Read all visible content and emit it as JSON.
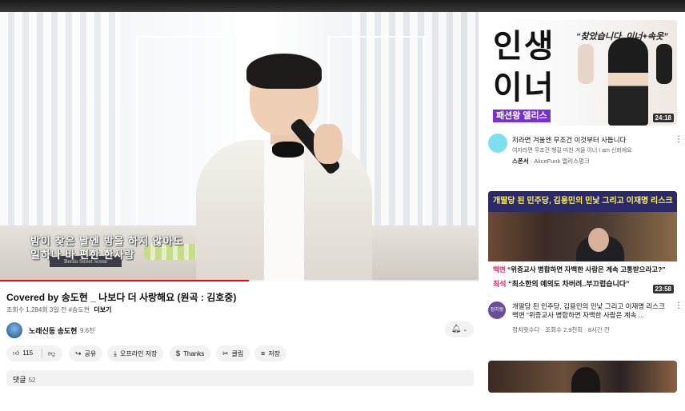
{
  "player": {
    "subtitle_line1": "밤이 찾은 날엔 밤을 하지 않아도",
    "subtitle_line2": "일하나 바 편한 한사람",
    "sign_text": "Berlin Street Scene",
    "progress_fraction": 0.52
  },
  "video": {
    "title": "Covered by 송도현 _ 나보다 더 사랑해요 (원곡 : 김호중)",
    "views": "조회수 1,284회",
    "age": "3일 전",
    "hashtag": "#송도현",
    "more_label": "더보기"
  },
  "channel": {
    "name": "노래신동 송도현",
    "subscribers": "9.6천",
    "bell_icon": "bell-icon"
  },
  "actions": {
    "likes": "115",
    "share": "공유",
    "offline_save": "오프라인 저장",
    "thanks": "Thanks",
    "clip": "클립",
    "save": "저장"
  },
  "comments": {
    "label": "댓글",
    "count": "52"
  },
  "sidebar": {
    "ad": {
      "thumb_big_line1": "인생",
      "thumb_big_line2": "이너",
      "thumb_quote": "“찾았습니다..이너+속옷”",
      "thumb_brand": "패션왕 엘리스",
      "duration": "24:18",
      "title": "저라면 겨울엔 무조건 이것부터 사듭니다",
      "description": "여자라면 무조건 챙길 미친 겨울 이너 I am 신뢰에요",
      "sponsor_label": "스폰서",
      "sponsor_name": "AliceFunk 엘리스펑크"
    },
    "news": {
      "thumb_header": "개딸당 된 민주당, 김용민의 민낯 그리고 이재명 리스크",
      "thumb_line1_prefix": "백변",
      "thumb_line1": "“위증교사 병합하면 자백한 사람은 계속 고통받으라고?”",
      "thumb_line2_prefix": "최석",
      "thumb_line2": "“최소한의 예의도 차버려..부끄럽습니다”",
      "duration": "23:58",
      "avatar_text": "정치왓수다",
      "title": "개딸당 된 민주당, 김용민의 민낯 그리고 이재명 리스크    백변 “위증교사 병합하면 자백한 사람은 계속 ...",
      "channel": "정치왓수다",
      "views": "조회수 2.9천회",
      "age": "8시간 전"
    }
  },
  "colors": {
    "progress": "#ff0000",
    "pill_bg": "#f2f2f2",
    "ad_brand": "#7a2fd0",
    "news_banner": "#2a2a6a",
    "news_highlight": "#ffee58"
  }
}
